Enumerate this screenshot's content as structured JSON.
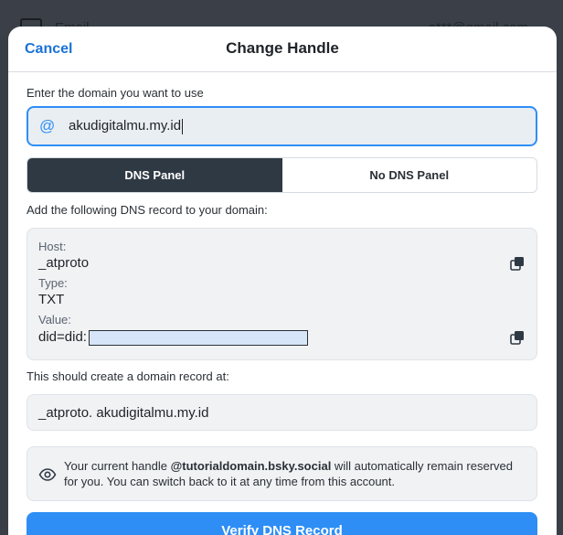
{
  "background": {
    "item_label": "Email",
    "item_value": "a***@gmail.com"
  },
  "modal": {
    "cancel_label": "Cancel",
    "title": "Change Handle",
    "domain_label": "Enter the domain you want to use",
    "domain_value": "akudigitalmu.my.id",
    "segments": {
      "active": "DNS Panel",
      "inactive": "No DNS Panel"
    },
    "add_record_label": "Add the following DNS record to your domain:",
    "record": {
      "host_label": "Host:",
      "host_value": "_atproto",
      "type_label": "Type:",
      "type_value": "TXT",
      "value_label": "Value:",
      "value_prefix": "did=did:"
    },
    "should_create_label": "This should create a domain record at:",
    "result_record": "_atproto. akudigitalmu.my.id",
    "info": {
      "prefix": "Your current handle ",
      "handle": "@tutorialdomain.bsky.social",
      "suffix": " will automatically remain reserved for you. You can switch back to it at any time from this account."
    },
    "verify_label": "Verify DNS Record"
  },
  "colors": {
    "accent": "#2e8ef5",
    "link": "#1a72d6",
    "segment_active": "#2f3944"
  }
}
